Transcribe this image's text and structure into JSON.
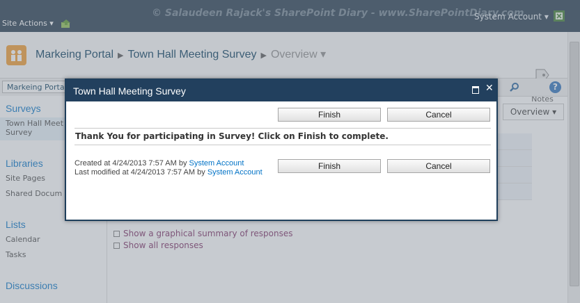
{
  "header": {
    "watermark": "© Salaudeen Rajack's SharePoint Diary - www.SharePointDiary.com",
    "site_actions": "Site Actions ▾",
    "user_menu": "System Account ▾"
  },
  "breadcrumb": {
    "site": "Markeing Portal",
    "list": "Town Hall Meeting Survey",
    "view": "Overview ▾"
  },
  "ribbon": {
    "tags_notes": "Tags & Notes"
  },
  "toolbar": {
    "portal_link": "Markeing Portal"
  },
  "nav": {
    "surveys_heading": "Surveys",
    "survey_item_line1": "Town Hall Meet",
    "survey_item_line2": "Survey",
    "libraries_heading": "Libraries",
    "site_pages": "Site Pages",
    "shared_docs": "Shared Docum",
    "lists_heading": "Lists",
    "calendar": "Calendar",
    "tasks": "Tasks",
    "discussions_heading": "Discussions"
  },
  "content": {
    "view_button": "Overview ▾",
    "summary_link": "Show a graphical summary of responses",
    "all_responses_link": "Show all responses"
  },
  "dialog": {
    "title": "Town Hall Meeting Survey",
    "finish_label": "Finish",
    "cancel_label": "Cancel",
    "message": "Thank You for participating in Survey! Click on Finish to complete.",
    "created_prefix": "Created at 4/24/2013 7:57 AM by",
    "created_by": "System Account",
    "modified_prefix": "Last modified at 4/24/2013 7:57 AM by",
    "modified_by": "System Account"
  }
}
